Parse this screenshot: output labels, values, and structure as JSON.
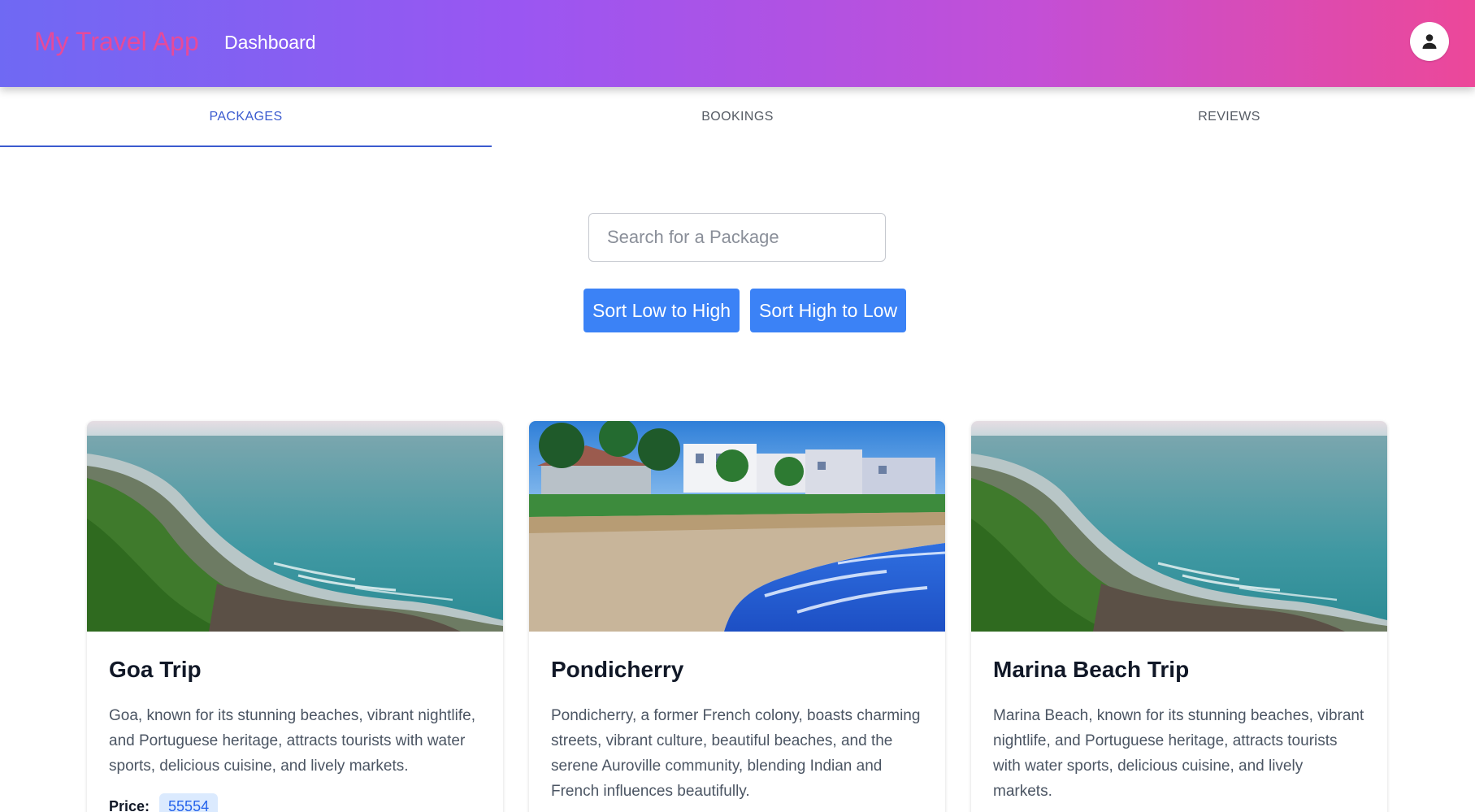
{
  "header": {
    "brand": "My Travel App",
    "nav_dashboard": "Dashboard",
    "avatar_icon": "user-circle-icon",
    "colors": {
      "gradient_start": "#6f69f3",
      "gradient_end": "#ec4899",
      "brand_text": "#e64a9a"
    }
  },
  "tabs": [
    {
      "label": "PACKAGES",
      "active": true
    },
    {
      "label": "BOOKINGS",
      "active": false
    },
    {
      "label": "REVIEWS",
      "active": false
    }
  ],
  "search": {
    "placeholder": "Search for a Package",
    "value": ""
  },
  "sort": {
    "low_to_high": "Sort Low to High",
    "high_to_low": "Sort High to Low",
    "button_color": "#3b82f6"
  },
  "packages": [
    {
      "title": "Goa Trip",
      "description": "Goa, known for its stunning beaches, vibrant nightlife, and Portuguese heritage, attracts tourists with water sports, delicious cuisine, and lively markets.",
      "price_label": "Price:",
      "price": "55554",
      "image": "coastal-cliff-beach-image"
    },
    {
      "title": "Pondicherry",
      "description": "Pondicherry, a former French colony, boasts charming streets, vibrant culture, beautiful beaches, and the serene Auroville community, blending Indian and French influences beautifully.",
      "image": "pondicherry-beach-town-image"
    },
    {
      "title": "Marina Beach Trip",
      "description": "Marina Beach, known for its stunning beaches, vibrant nightlife, and Portuguese heritage, attracts tourists with water sports, delicious cuisine, and lively markets.",
      "image": "coastal-cliff-beach-image"
    }
  ]
}
